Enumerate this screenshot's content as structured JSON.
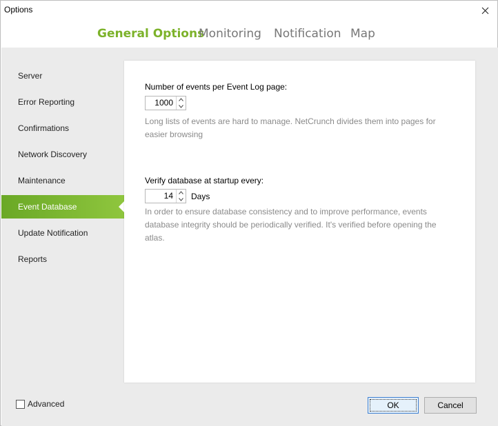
{
  "window": {
    "title": "Options"
  },
  "tabs": [
    {
      "label": "General Options",
      "active": true
    },
    {
      "label": "Monitoring",
      "active": false
    },
    {
      "label": "Notification",
      "active": false
    },
    {
      "label": "Map",
      "active": false
    }
  ],
  "sidebar": {
    "items": [
      {
        "label": "Server"
      },
      {
        "label": "Error Reporting"
      },
      {
        "label": "Confirmations"
      },
      {
        "label": "Network Discovery"
      },
      {
        "label": "Maintenance"
      },
      {
        "label": "Event Database",
        "active": true
      },
      {
        "label": "Update Notification"
      },
      {
        "label": "Reports"
      }
    ]
  },
  "panel": {
    "events_per_page": {
      "label": "Number of events per Event Log page:",
      "value": "1000",
      "description": "Long lists of events are hard to manage. NetCrunch divides them into pages for easier browsing"
    },
    "verify_db": {
      "label": "Verify database at startup every:",
      "value": "14",
      "unit": "Days",
      "description": "In order to ensure database consistency and to improve performance, events database integrity should be periodically verified. It's verified before opening the atlas."
    }
  },
  "footer": {
    "advanced_label": "Advanced",
    "advanced_checked": false,
    "ok_label": "OK",
    "cancel_label": "Cancel"
  },
  "colors": {
    "accent": "#7cb22a",
    "active_item_bg": "#7db733"
  },
  "icons": {
    "close": "close-icon",
    "spin_up": "chevron-up-icon",
    "spin_down": "chevron-down-icon"
  }
}
